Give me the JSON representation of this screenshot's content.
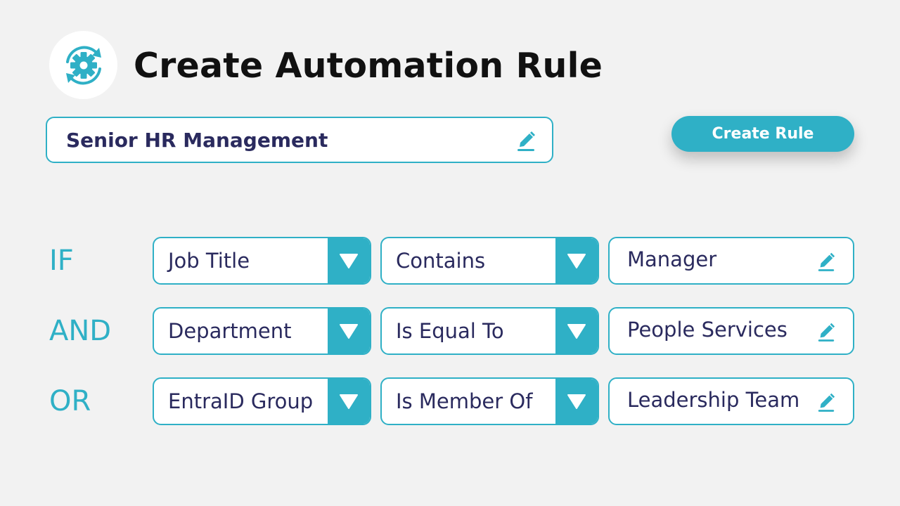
{
  "header": {
    "title": "Create Automation Rule",
    "logo_icon": "gear-sync-icon"
  },
  "rule_name": {
    "value": "Senior HR Management",
    "edit_icon": "pencil-icon"
  },
  "actions": {
    "create_label": "Create Rule"
  },
  "conditions": [
    {
      "operator": "IF",
      "field": "Job Title",
      "condition": "Contains",
      "value": "Manager"
    },
    {
      "operator": "AND",
      "field": "Department",
      "condition": "Is Equal To",
      "value": "People Services"
    },
    {
      "operator": "OR",
      "field": "EntraID Group",
      "condition": "Is Member Of",
      "value": "Leadership Team"
    }
  ],
  "colors": {
    "accent": "#2fb0c6",
    "text_dark": "#2a2a5e",
    "title": "#111111",
    "background": "#f2f2f2"
  }
}
